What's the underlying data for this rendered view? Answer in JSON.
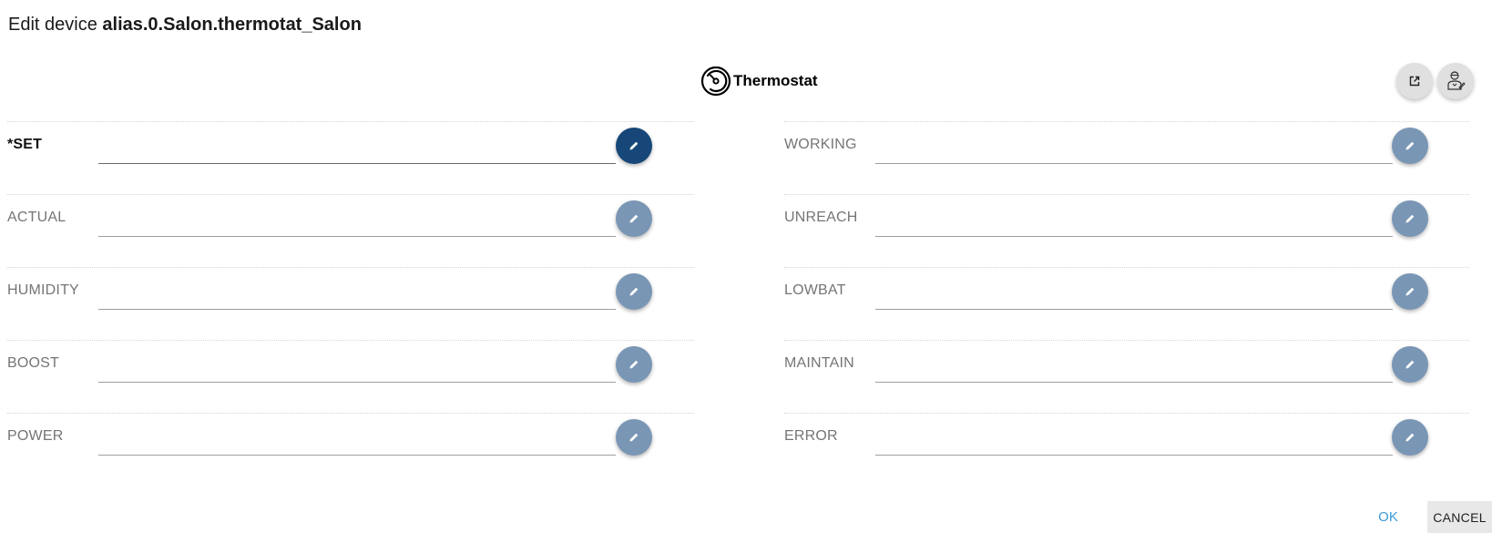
{
  "dialog": {
    "title_prefix": "Edit device ",
    "device_id": "alias.0.Salon.thermotat_Salon"
  },
  "device_type": {
    "icon": "thermostat-dial-icon",
    "label": "Thermostat"
  },
  "header_buttons": {
    "open": {
      "icon": "open-in-new-icon"
    },
    "expert": {
      "icon": "expert-user-icon"
    }
  },
  "states_left": [
    {
      "label": "*SET",
      "required": true,
      "value": ""
    },
    {
      "label": "ACTUAL",
      "required": false,
      "value": ""
    },
    {
      "label": "HUMIDITY",
      "required": false,
      "value": ""
    },
    {
      "label": "BOOST",
      "required": false,
      "value": ""
    },
    {
      "label": "POWER",
      "required": false,
      "value": ""
    }
  ],
  "states_right": [
    {
      "label": "WORKING",
      "required": false,
      "value": ""
    },
    {
      "label": "UNREACH",
      "required": false,
      "value": ""
    },
    {
      "label": "LOWBAT",
      "required": false,
      "value": ""
    },
    {
      "label": "MAINTAIN",
      "required": false,
      "value": ""
    },
    {
      "label": "ERROR",
      "required": false,
      "value": ""
    }
  ],
  "edit_icon": "pencil-icon",
  "actions": {
    "ok_label": "OK",
    "cancel_label": "CANCEL"
  },
  "colors": {
    "edit_button": "#7a96b5",
    "edit_button_active": "#164778",
    "ok_text": "#3b9ad9"
  }
}
